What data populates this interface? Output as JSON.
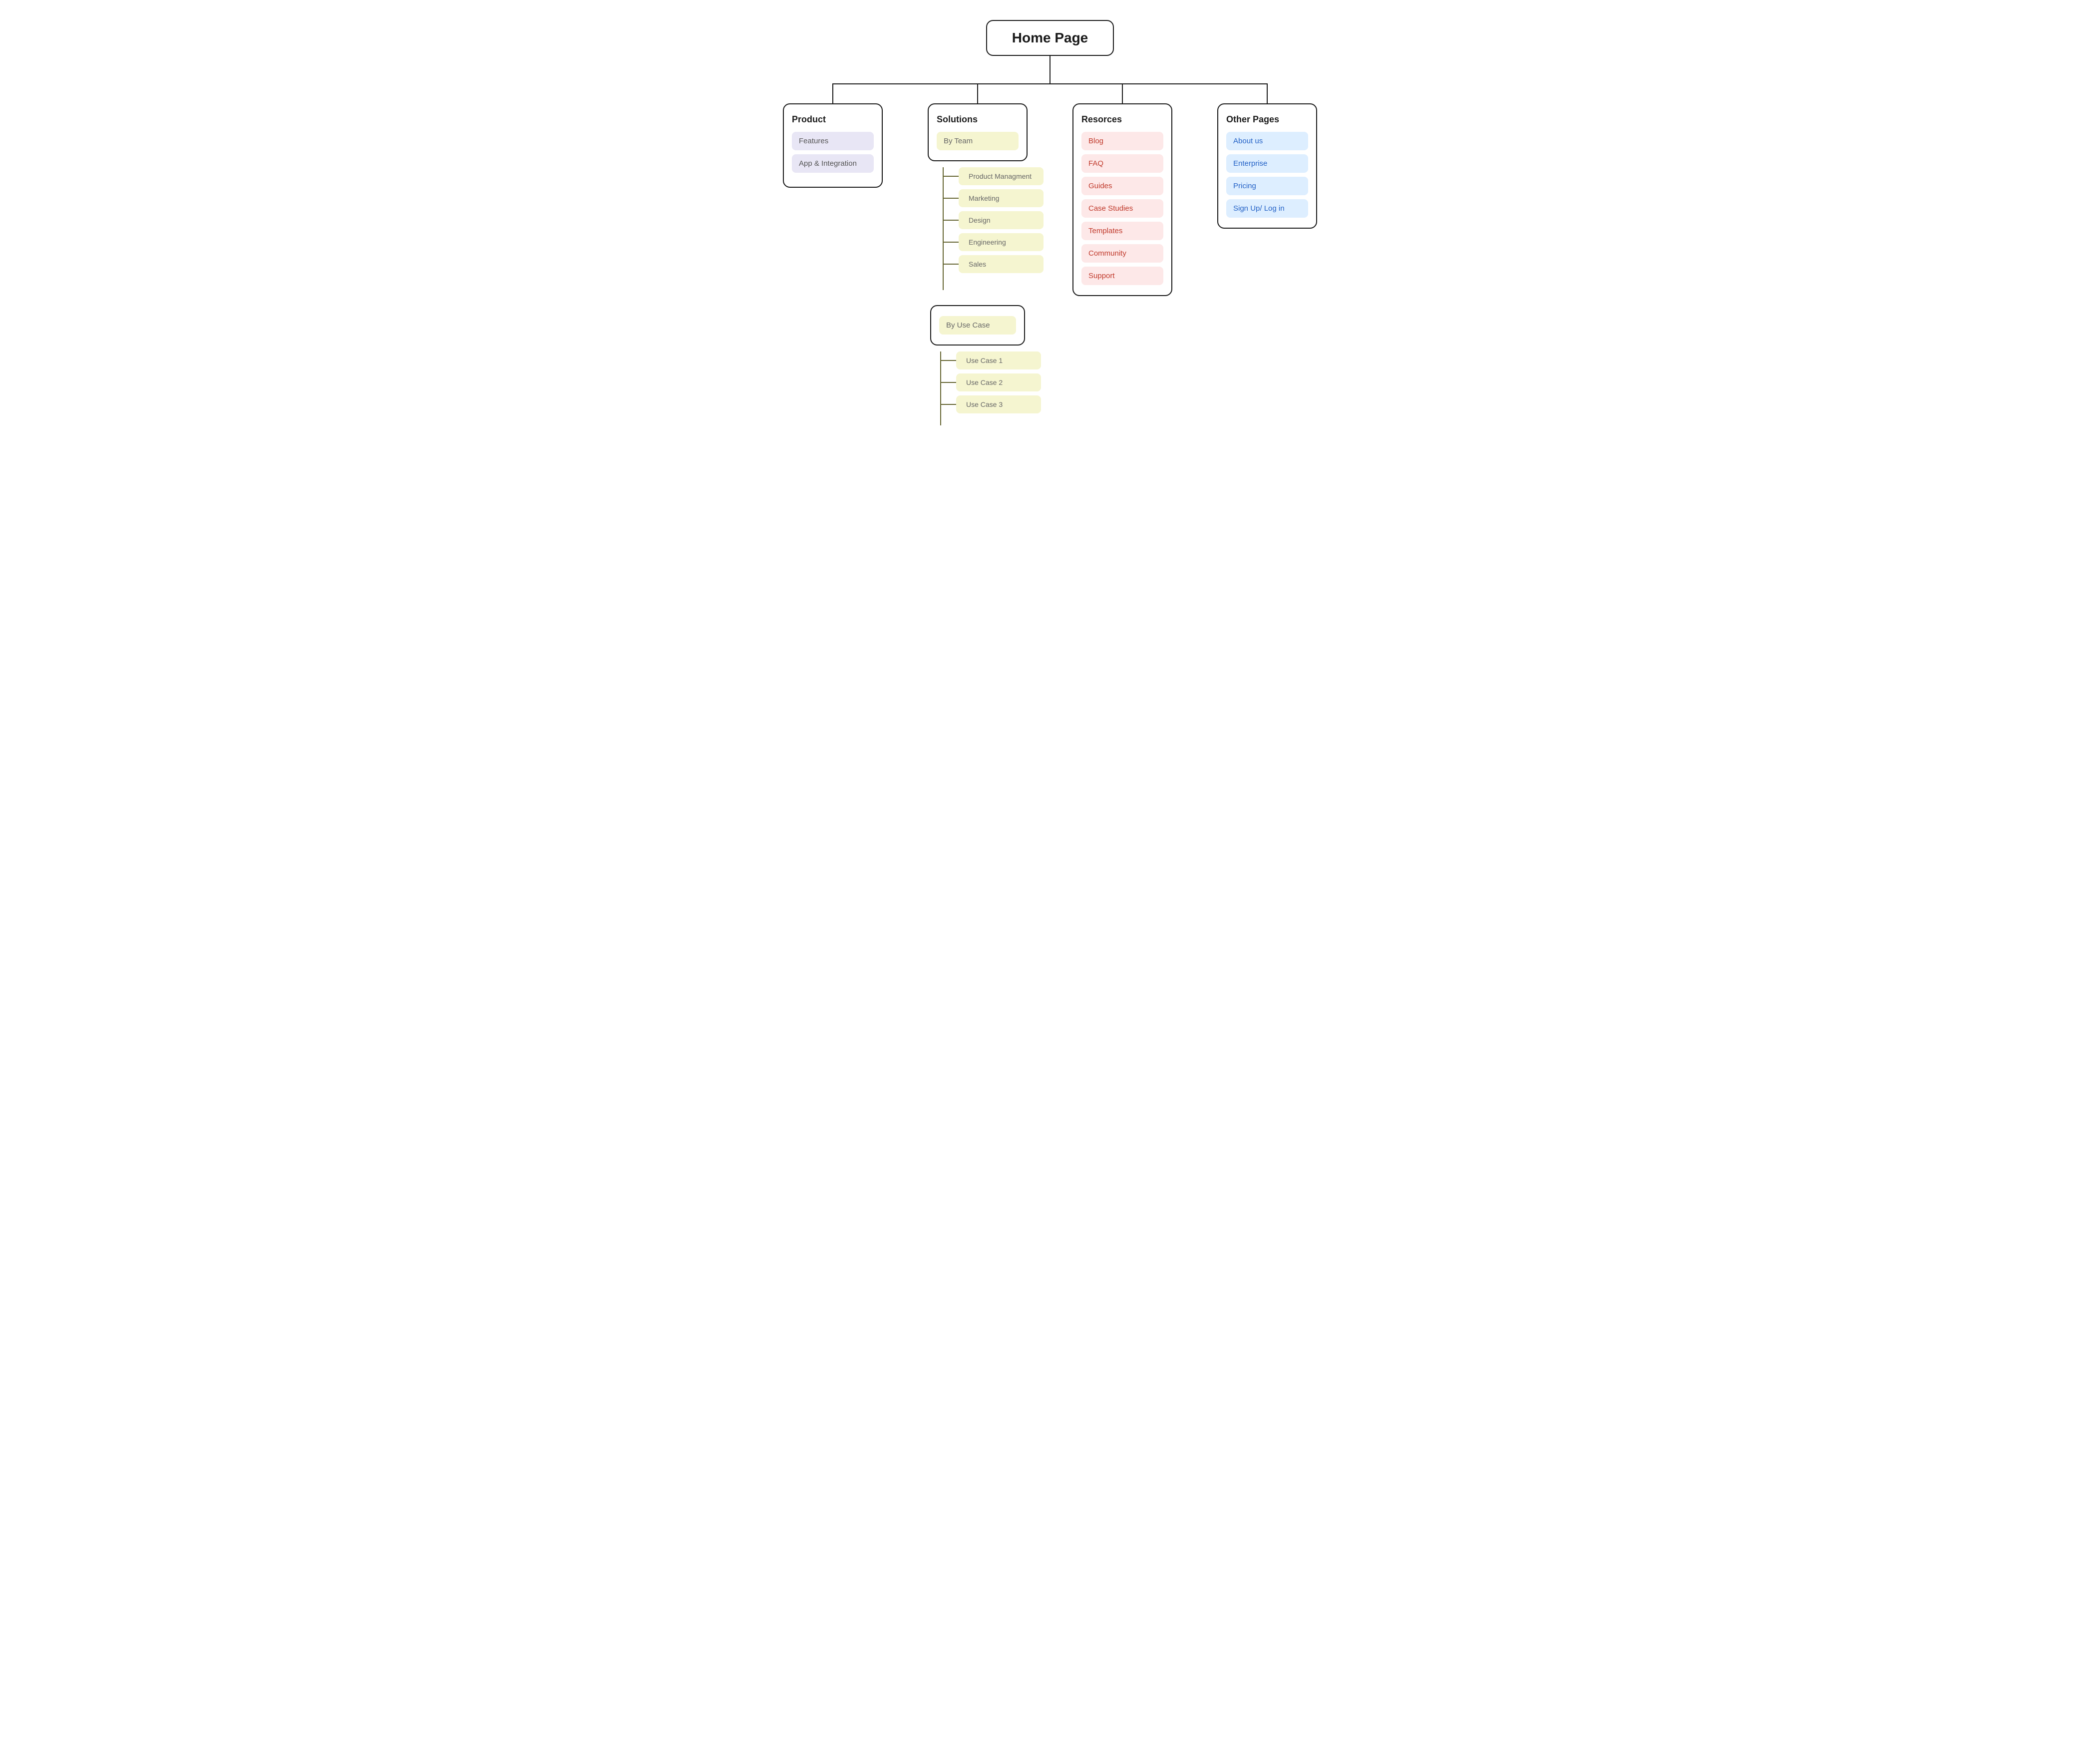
{
  "root": {
    "label": "Home Page"
  },
  "product": {
    "title": "Product",
    "items": [
      {
        "label": "Features"
      },
      {
        "label": "App & Integration"
      }
    ]
  },
  "solutions": {
    "title": "Solutions",
    "byTeam": {
      "label": "By Team",
      "children": [
        {
          "label": "Product Managment"
        },
        {
          "label": "Marketing"
        },
        {
          "label": "Design"
        },
        {
          "label": "Engineering"
        },
        {
          "label": "Sales"
        }
      ]
    },
    "byUseCase": {
      "label": "By Use Case",
      "children": [
        {
          "label": "Use Case 1"
        },
        {
          "label": "Use Case 2"
        },
        {
          "label": "Use Case 3"
        }
      ]
    }
  },
  "resources": {
    "title": "Resorces",
    "items": [
      {
        "label": "Blog"
      },
      {
        "label": "FAQ"
      },
      {
        "label": "Guides"
      },
      {
        "label": "Case Studies"
      },
      {
        "label": "Templates"
      },
      {
        "label": "Community"
      },
      {
        "label": "Support"
      }
    ]
  },
  "otherPages": {
    "title": "Other Pages",
    "items": [
      {
        "label": "About us"
      },
      {
        "label": "Enterprise"
      },
      {
        "label": "Pricing"
      },
      {
        "label": "Sign Up/ Log in"
      }
    ]
  }
}
